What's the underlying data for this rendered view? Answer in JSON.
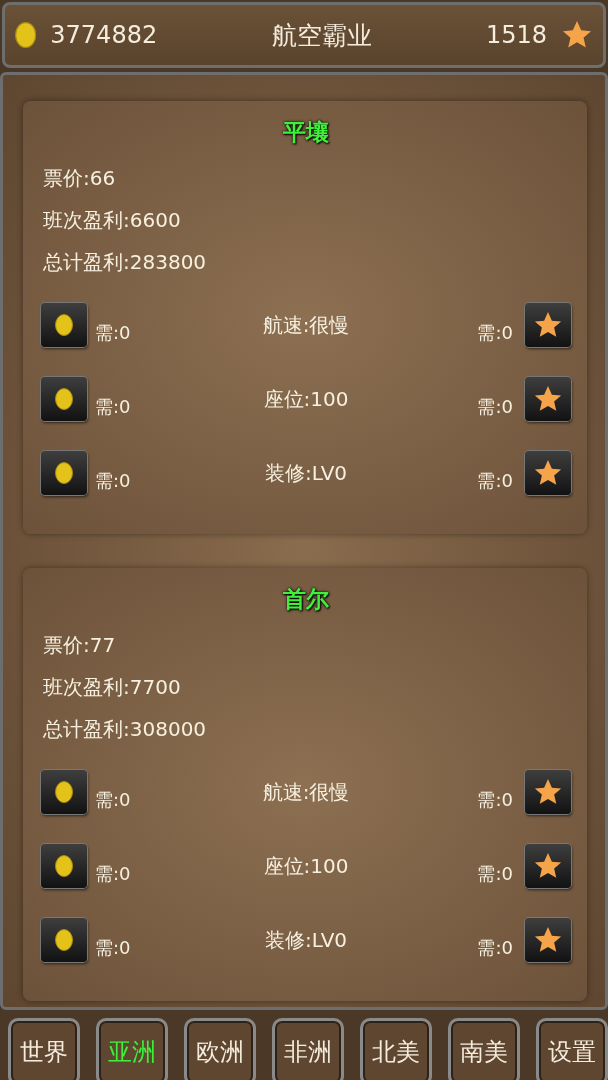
{
  "header": {
    "coins": "3774882",
    "title": "航空霸业",
    "stars_count": "1518"
  },
  "routes": [
    {
      "city": "平壤",
      "stats": [
        "票价:66",
        "班次盈利:6600",
        "总计盈利:283800"
      ],
      "upgrades": [
        {
          "coin_cost": "需:0",
          "label": "航速:很慢",
          "star_cost": "需:0"
        },
        {
          "coin_cost": "需:0",
          "label": "座位:100",
          "star_cost": "需:0"
        },
        {
          "coin_cost": "需:0",
          "label": "装修:LV0",
          "star_cost": "需:0"
        }
      ]
    },
    {
      "city": "首尔",
      "stats": [
        "票价:77",
        "班次盈利:7700",
        "总计盈利:308000"
      ],
      "upgrades": [
        {
          "coin_cost": "需:0",
          "label": "航速:很慢",
          "star_cost": "需:0"
        },
        {
          "coin_cost": "需:0",
          "label": "座位:100",
          "star_cost": "需:0"
        },
        {
          "coin_cost": "需:0",
          "label": "装修:LV0",
          "star_cost": "需:0"
        }
      ]
    }
  ],
  "tabs": [
    {
      "label": "世界",
      "selected": false
    },
    {
      "label": "亚洲",
      "selected": true
    },
    {
      "label": "欧洲",
      "selected": false
    },
    {
      "label": "非洲",
      "selected": false
    },
    {
      "label": "北美",
      "selected": false
    },
    {
      "label": "南美",
      "selected": false
    },
    {
      "label": "设置",
      "selected": false
    }
  ]
}
